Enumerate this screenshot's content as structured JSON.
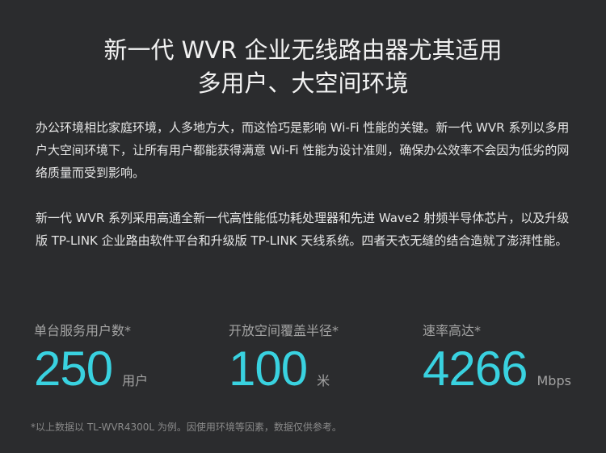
{
  "headline": {
    "line1": "新一代 WVR 企业无线路由器尤其适用",
    "line2": "多用户、大空间环境"
  },
  "paragraphs": [
    "办公环境相比家庭环境，人多地方大，而这恰巧是影响 Wi-Fi 性能的关键。新一代 WVR 系列以多用户大空间环境下，让所有用户都能获得满意 Wi-Fi 性能为设计准则，确保办公效率不会因为低劣的网络质量而受到影响。",
    "新一代 WVR 系列采用高通全新一代高性能低功耗处理器和先进 Wave2 射频半导体芯片，以及升级版 TP-LINK 企业路由软件平台和升级版 TP-LINK 天线系统。四者天衣无缝的结合造就了澎湃性能。"
  ],
  "stats": [
    {
      "label": "单台服务用户数*",
      "value": "250",
      "unit": "用户"
    },
    {
      "label": "开放空间覆盖半径*",
      "value": "100",
      "unit": "米"
    },
    {
      "label": "速率高达*",
      "value": "4266",
      "unit": "Mbps"
    }
  ],
  "footnote": "*以上数据以 TL-WVR4300L 为例。因使用环境等因素，数据仅供参考。",
  "colors": {
    "background": "#2b2c2e",
    "accent": "#39d2e0",
    "text": "#e6e6e6",
    "muted": "#a3a3a3"
  }
}
